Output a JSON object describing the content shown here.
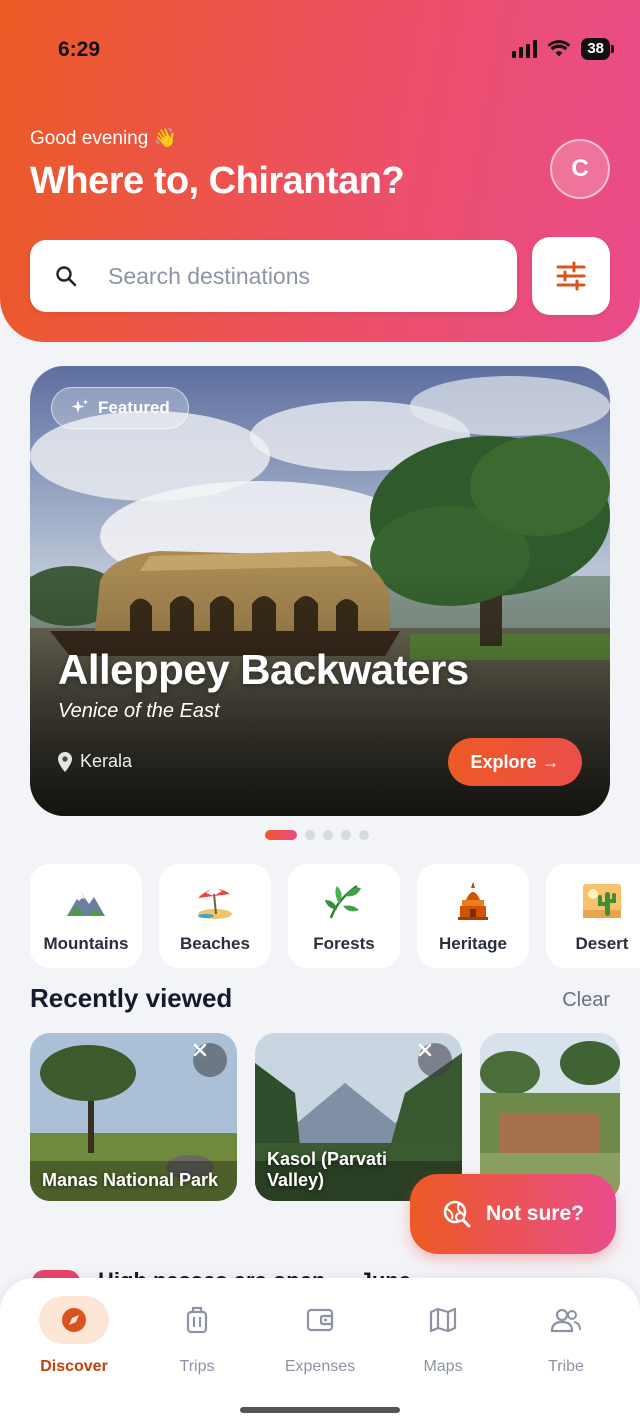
{
  "status_bar": {
    "time": "6:29",
    "battery": "38"
  },
  "header": {
    "greeting": "Good evening 👋",
    "headline": "Where to, Chirantan?",
    "avatar_initial": "C"
  },
  "search": {
    "placeholder": "Search destinations"
  },
  "featured": {
    "badge": "Featured",
    "title": "Alleppey Backwaters",
    "subtitle": "Venice of the East",
    "location": "Kerala",
    "cta": "Explore →",
    "page_count": 5,
    "active_page": 1
  },
  "categories": [
    {
      "label": "Mountains",
      "icon": "mountain-icon"
    },
    {
      "label": "Beaches",
      "icon": "beach-umbrella-icon"
    },
    {
      "label": "Forests",
      "icon": "leaf-icon"
    },
    {
      "label": "Heritage",
      "icon": "temple-icon"
    },
    {
      "label": "Desert",
      "icon": "cactus-icon"
    }
  ],
  "recently_viewed": {
    "title": "Recently viewed",
    "clear_label": "Clear",
    "items": [
      {
        "name": "Manas National Park"
      },
      {
        "name": "Kasol (Parvati Valley)"
      },
      {
        "name": ""
      }
    ]
  },
  "not_sure_button": "Not sure?",
  "peek_text": "High passes are open — June",
  "bottom_nav": [
    {
      "label": "Discover",
      "icon": "compass-icon",
      "active": true
    },
    {
      "label": "Trips",
      "icon": "luggage-icon",
      "active": false
    },
    {
      "label": "Expenses",
      "icon": "wallet-icon",
      "active": false
    },
    {
      "label": "Maps",
      "icon": "map-icon",
      "active": false
    },
    {
      "label": "Tribe",
      "icon": "people-icon",
      "active": false
    }
  ],
  "colors": {
    "accent_start": "#ec5a24",
    "accent_end": "#ea4c8c",
    "active_nav": "#c2410c"
  }
}
